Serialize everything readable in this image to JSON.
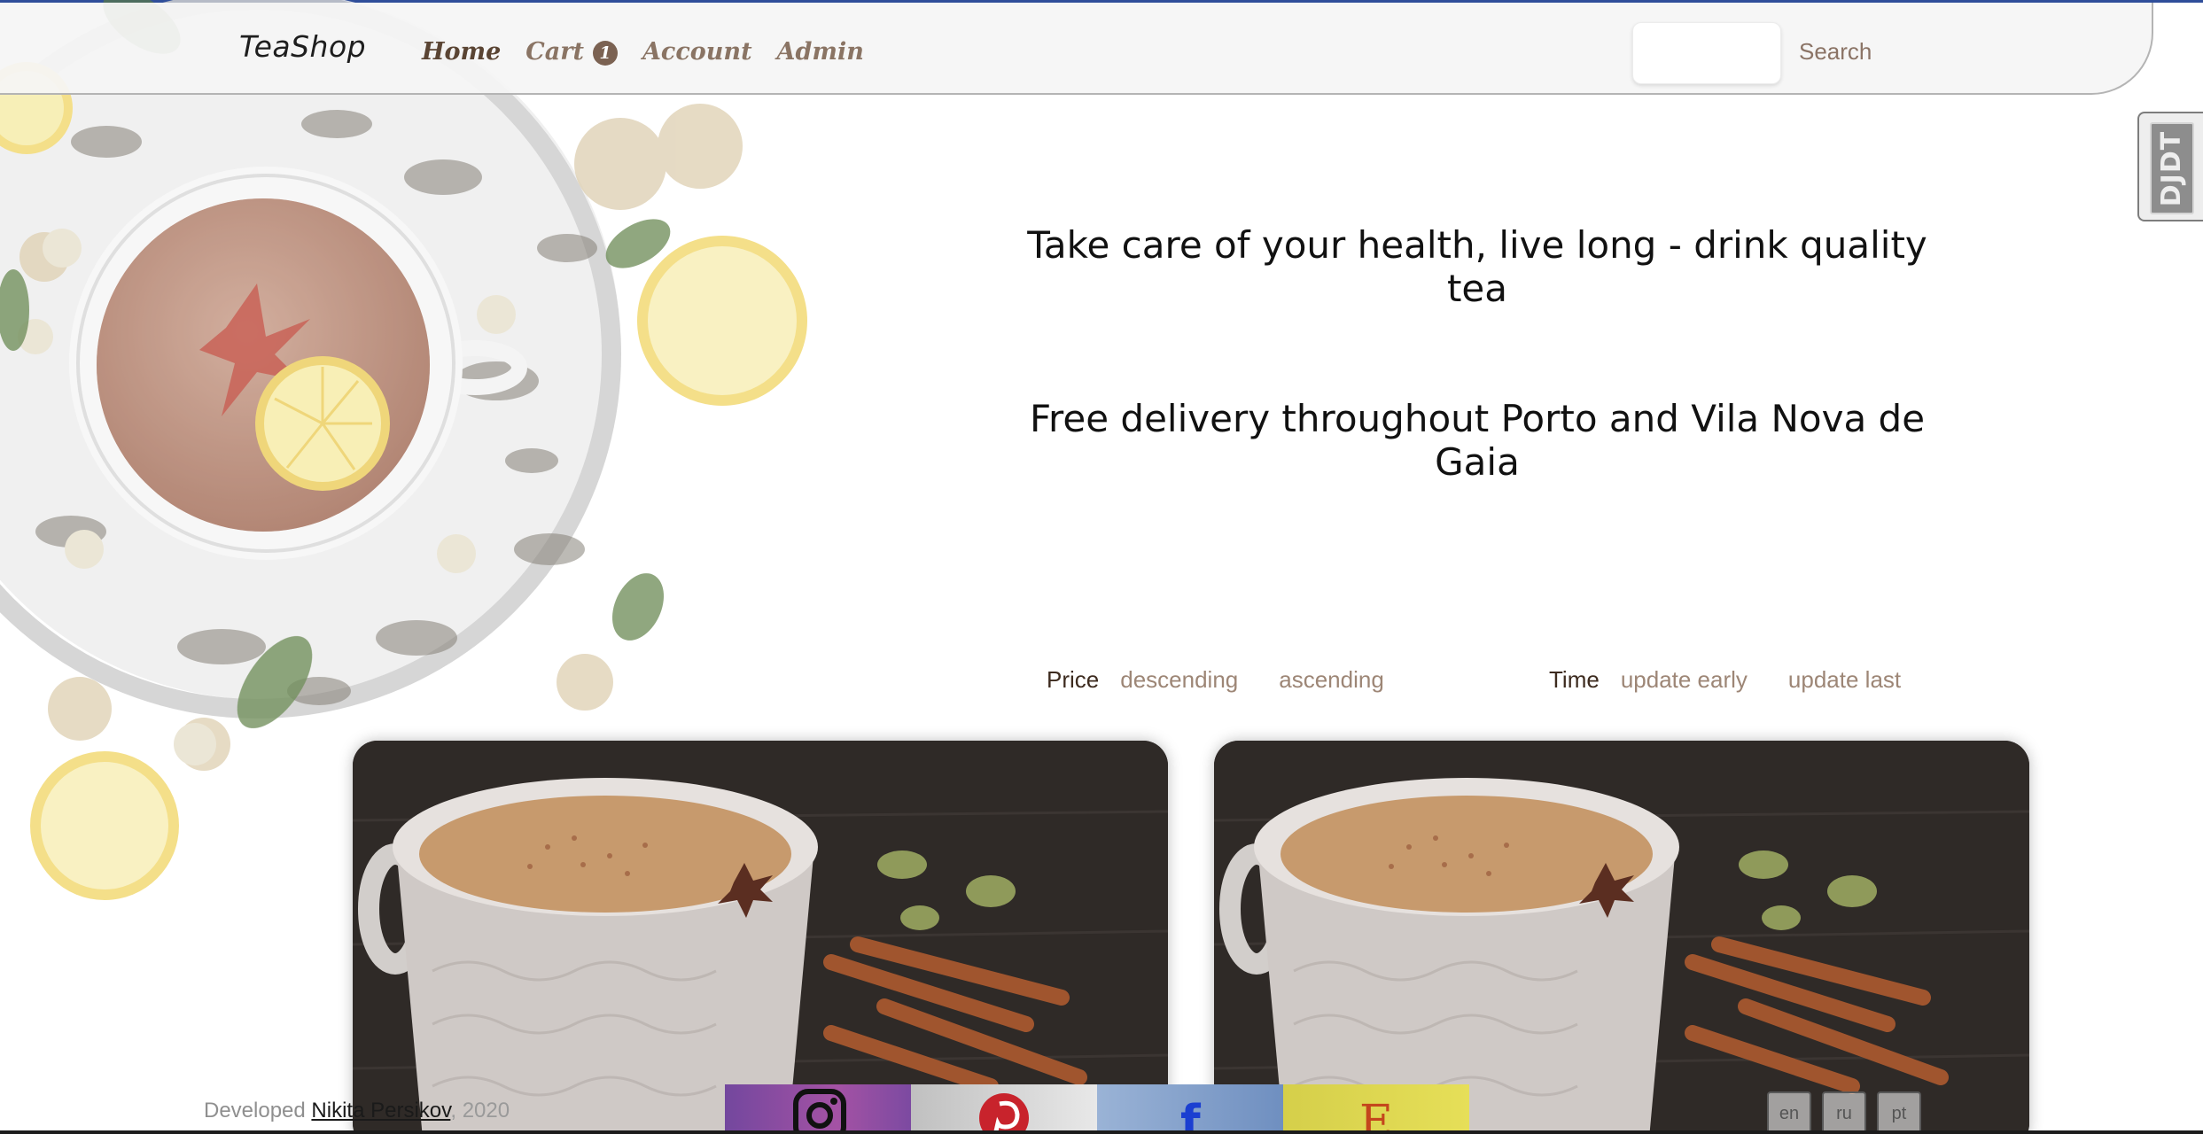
{
  "header": {
    "logo": "TeaShop",
    "nav": [
      {
        "label": "Home",
        "active": true
      },
      {
        "label": "Cart",
        "badge": "1"
      },
      {
        "label": "Account"
      },
      {
        "label": "Admin"
      }
    ],
    "search": {
      "placeholder": "",
      "button_label": "Search"
    }
  },
  "debug_toolbar": {
    "label": "DJDT"
  },
  "hero": {
    "headline": "Take care of your health, live long - drink quality tea",
    "subheadline": "Free delivery throughout Porto and Vila Nova de Gaia"
  },
  "sort": {
    "price": {
      "label": "Price",
      "options": [
        "descending",
        "ascending"
      ]
    },
    "time": {
      "label": "Time",
      "options": [
        "update early",
        "update last"
      ]
    }
  },
  "products": [
    {
      "image": "masala-chai-cup-photo"
    },
    {
      "image": "masala-chai-cup-photo"
    }
  ],
  "footer": {
    "credit_prefix": "Developed",
    "credit_author": "Nikita Persikov",
    "credit_suffix": ", 2020",
    "social": [
      "instagram-icon",
      "pinterest-icon",
      "facebook-icon",
      "etsy-icon"
    ],
    "etsy_letter": "E",
    "facebook_letter": "f",
    "languages": [
      "en",
      "ru",
      "pt"
    ]
  },
  "colors": {
    "nav_text": "#8a7464",
    "nav_active": "#5a4433",
    "accent_brown": "#7b6252",
    "debug_bar": "#2f4e9a"
  }
}
